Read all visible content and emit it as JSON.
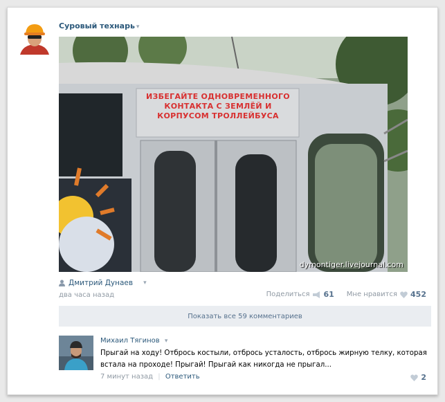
{
  "post": {
    "author": "Суровый технарь",
    "caret": "▾",
    "image_sign": "ИЗБЕГАЙТЕ ОДНОВРЕМЕННОГО КОНТАКТА С ЗЕМЛЁЙ И КОРПУСОМ ТРОЛЛЕЙБУСА",
    "watermark": "dymontiger.livejournal.com"
  },
  "meta": {
    "user": "Дмитрий Дунаев",
    "caret": "▾",
    "time": "два часа назад",
    "share_label": "Поделиться",
    "share_count": "61",
    "like_label": "Мне нравится",
    "like_count": "452"
  },
  "comments": {
    "show_all": "Показать все 59 комментариев",
    "item": {
      "author": "Михаил Тягинов",
      "caret": "▾",
      "text": "Прыгай на ходу! Отбрось костыли, отбрось усталость, отбрось жирную телку, которая встала на проходе! Прыгай! Прыгай как никогда не прыгал...",
      "time": "7 минут назад",
      "separator": "|",
      "reply": "Ответить",
      "likes": "2"
    }
  },
  "colors": {
    "link": "#2b587a",
    "muted": "#8f99a3",
    "sign_red": "#d83030"
  }
}
